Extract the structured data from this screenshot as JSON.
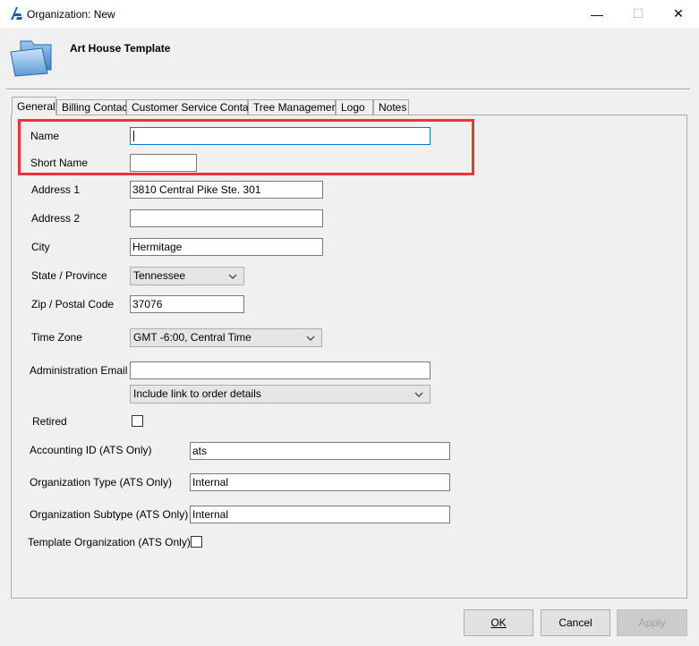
{
  "window": {
    "title": "Organization: New",
    "min_glyph": "—",
    "max_glyph": "☐",
    "close_glyph": "✕"
  },
  "header": {
    "title": "Art House Template"
  },
  "tabs": [
    {
      "label": "General"
    },
    {
      "label": "Billing Contact"
    },
    {
      "label": "Customer Service Contact"
    },
    {
      "label": "Tree Management"
    },
    {
      "label": "Logo"
    },
    {
      "label": "Notes"
    }
  ],
  "form": {
    "name": {
      "label": "Name",
      "value": ""
    },
    "short_name": {
      "label": "Short Name",
      "value": ""
    },
    "address1": {
      "label": "Address 1",
      "value": "3810 Central Pike Ste. 301"
    },
    "address2": {
      "label": "Address 2",
      "value": ""
    },
    "city": {
      "label": "City",
      "value": "Hermitage"
    },
    "state": {
      "label": "State / Province",
      "value": "Tennessee"
    },
    "zip": {
      "label": "Zip / Postal Code",
      "value": "37076"
    },
    "timezone": {
      "label": "Time Zone",
      "value": "GMT -6:00, Central Time"
    },
    "admin_email": {
      "label": "Administration Email",
      "value": "",
      "option": "Include link to order details"
    },
    "retired": {
      "label": "Retired",
      "checked": false
    },
    "accounting_id": {
      "label": "Accounting ID (ATS Only)",
      "value": "ats"
    },
    "org_type": {
      "label": "Organization Type (ATS Only)",
      "value": "Internal"
    },
    "org_subtype": {
      "label": "Organization Subtype (ATS Only)",
      "value": "Internal"
    },
    "template_org": {
      "label": "Template Organization (ATS Only)",
      "checked": false
    }
  },
  "buttons": {
    "ok": "OK",
    "cancel": "Cancel",
    "apply": "Apply"
  },
  "colors": {
    "highlight": "#e8343a",
    "focus_border": "#0078d7",
    "app_icon": "#1a5fb4"
  }
}
